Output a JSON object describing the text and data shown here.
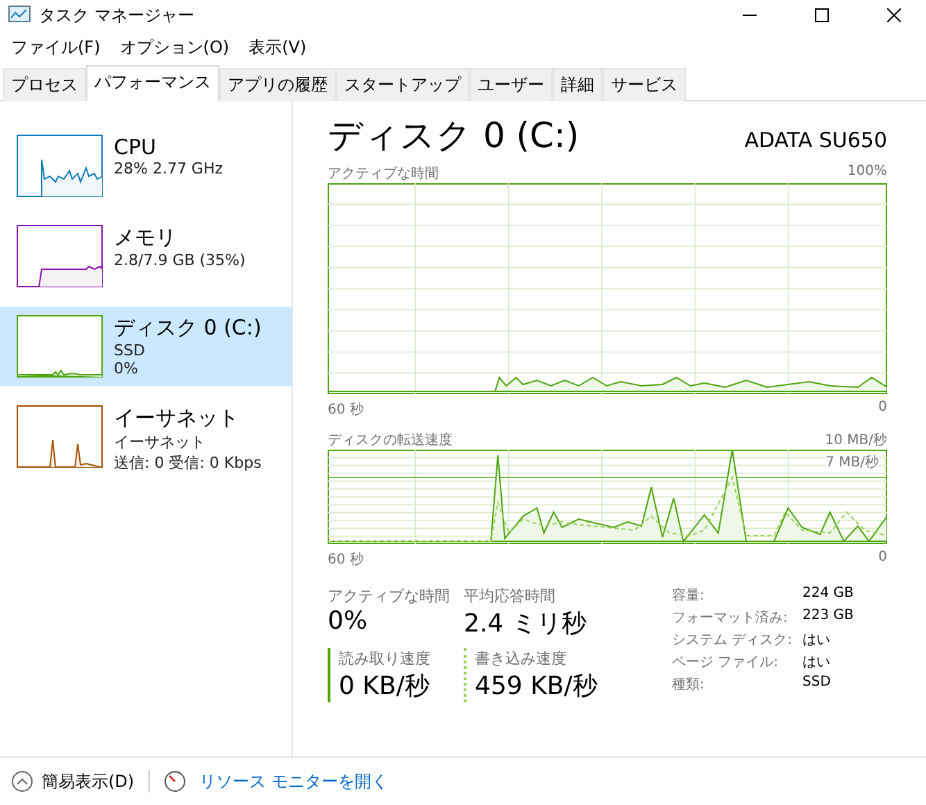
{
  "window": {
    "title": "タスク マネージャー"
  },
  "menu": [
    "ファイル(F)",
    "オプション(O)",
    "表示(V)"
  ],
  "tabs": [
    {
      "label": "プロセス",
      "selected": false
    },
    {
      "label": "パフォーマンス",
      "selected": true
    },
    {
      "label": "アプリの履歴",
      "selected": false
    },
    {
      "label": "スタートアップ",
      "selected": false
    },
    {
      "label": "ユーザー",
      "selected": false
    },
    {
      "label": "詳細",
      "selected": false
    },
    {
      "label": "サービス",
      "selected": false
    }
  ],
  "sidebar": {
    "items": [
      {
        "kind": "cpu",
        "name": "CPU",
        "lines": [
          "28%  2.77 GHz"
        ],
        "selected": false
      },
      {
        "kind": "memory",
        "name": "メモリ",
        "lines": [
          "2.8/7.9 GB (35%)"
        ],
        "selected": false
      },
      {
        "kind": "disk",
        "name": "ディスク 0 (C:)",
        "lines": [
          "SSD",
          "0%"
        ],
        "selected": true
      },
      {
        "kind": "ethernet",
        "name": "イーサネット",
        "lines": [
          "イーサネット",
          "送信: 0 受信: 0 Kbps"
        ],
        "selected": false
      }
    ]
  },
  "detail": {
    "title": "ディスク 0 (C:)",
    "model": "ADATA SU650",
    "graphs": [
      {
        "kind": "active",
        "label": "アクティブな時間",
        "max": "100%",
        "time": "60 秒",
        "min": "0"
      },
      {
        "kind": "transfer",
        "label": "ディスクの転送速度",
        "max": "10 MB/秒",
        "inner": "7 MB/秒",
        "time": "60 秒",
        "min": "0"
      }
    ],
    "stats": [
      {
        "label": "アクティブな時間",
        "value": "0%",
        "kind": "plain"
      },
      {
        "label": "平均応答時間",
        "value": "2.4 ミリ秒",
        "kind": "plain"
      },
      {
        "label": "読み取り速度",
        "value": "0 KB/秒",
        "kind": "read"
      },
      {
        "label": "書き込み速度",
        "value": "459 KB/秒",
        "kind": "write"
      }
    ],
    "properties": [
      {
        "label": "容量:",
        "value": "224 GB"
      },
      {
        "label": "フォーマット済み:",
        "value": "223 GB"
      },
      {
        "label": "システム ディスク:",
        "value": "はい"
      },
      {
        "label": "ページ ファイル:",
        "value": "はい"
      },
      {
        "label": "種類:",
        "value": "SSD"
      }
    ]
  },
  "footer": {
    "fewer": "簡易表示(D)",
    "monitor": "リソース モニターを開く"
  }
}
